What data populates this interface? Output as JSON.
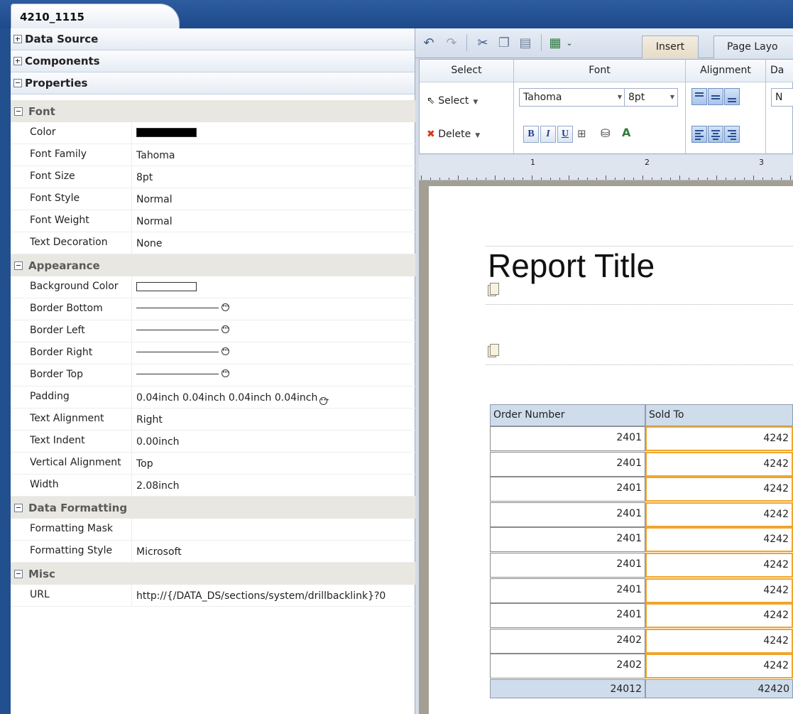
{
  "window": {
    "tab_title": "4210_1115"
  },
  "accordion": [
    {
      "label": "Data Source",
      "expanded": false
    },
    {
      "label": "Components",
      "expanded": false
    },
    {
      "label": "Properties",
      "expanded": true
    }
  ],
  "properties": {
    "font": {
      "label": "Font",
      "rows": [
        {
          "label": "Color",
          "value": "",
          "swatch": "#000000"
        },
        {
          "label": "Font Family",
          "value": "Tahoma"
        },
        {
          "label": "Font Size",
          "value": "8pt"
        },
        {
          "label": "Font Style",
          "value": "Normal"
        },
        {
          "label": "Font Weight",
          "value": "Normal"
        },
        {
          "label": "Text Decoration",
          "value": "None"
        }
      ]
    },
    "appearance": {
      "label": "Appearance",
      "rows": [
        {
          "label": "Background Color",
          "value": "",
          "swatch": "#ffffff"
        },
        {
          "label": "Border Bottom",
          "value": ""
        },
        {
          "label": "Border Left",
          "value": ""
        },
        {
          "label": "Border Right",
          "value": ""
        },
        {
          "label": "Border Top",
          "value": ""
        },
        {
          "label": "Padding",
          "value": "0.04inch 0.04inch 0.04inch 0.04inch"
        },
        {
          "label": "Text Alignment",
          "value": "Right"
        },
        {
          "label": "Text Indent",
          "value": "0.00inch"
        },
        {
          "label": "Vertical Alignment",
          "value": "Top"
        },
        {
          "label": "Width",
          "value": "2.08inch"
        }
      ]
    },
    "data_formatting": {
      "label": "Data Formatting",
      "rows": [
        {
          "label": "Formatting Mask",
          "value": ""
        },
        {
          "label": "Formatting Style",
          "value": "Microsoft"
        }
      ]
    },
    "misc": {
      "label": "Misc",
      "rows": [
        {
          "label": "URL",
          "value": "http://{/DATA_DS/sections/system/drillbacklink}?0"
        }
      ]
    }
  },
  "toolbar": {
    "tabs": [
      {
        "label": "Insert",
        "active": true
      },
      {
        "label": "Page Layo",
        "active": false
      }
    ]
  },
  "ribbon": {
    "groups": {
      "select": "Select",
      "font": "Font",
      "alignment": "Alignment",
      "data": "Da"
    },
    "select_button": "Select",
    "delete_button": "Delete",
    "font_family": "Tahoma",
    "font_size": "8pt",
    "data_combo": "N",
    "bold": "B",
    "italic": "I",
    "underline": "U"
  },
  "ruler": {
    "marks": [
      "1",
      "2",
      "3"
    ]
  },
  "report": {
    "title": "Report Title",
    "columns": [
      "Order Number",
      "Sold To"
    ],
    "rows": [
      [
        "2401",
        "4242"
      ],
      [
        "2401",
        "4242"
      ],
      [
        "2401",
        "4242"
      ],
      [
        "2401",
        "4242"
      ],
      [
        "2401",
        "4242"
      ],
      [
        "2401",
        "4242"
      ],
      [
        "2401",
        "4242"
      ],
      [
        "2401",
        "4242"
      ],
      [
        "2402",
        "4242"
      ],
      [
        "2402",
        "4242"
      ]
    ],
    "totals": [
      "24012",
      "42420"
    ]
  }
}
